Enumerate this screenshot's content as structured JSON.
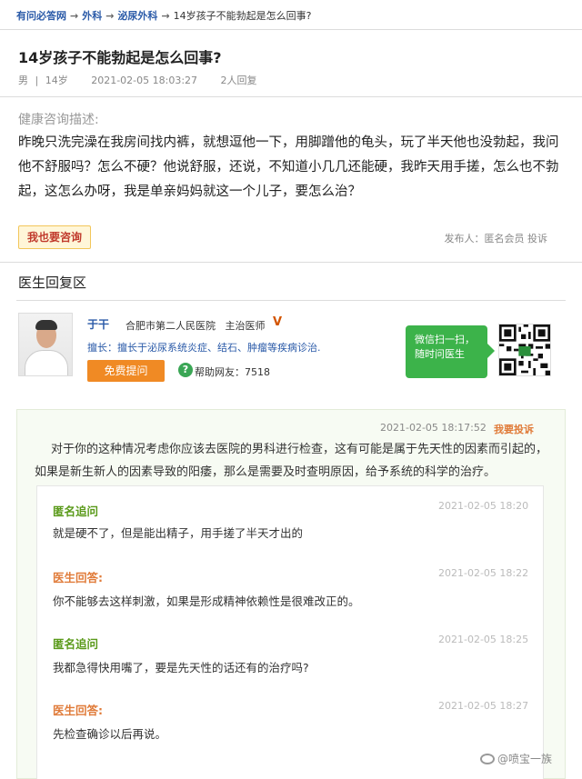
{
  "breadcrumb": {
    "items": [
      "有问必答网",
      "外科",
      "泌尿外科"
    ],
    "current": "14岁孩子不能勃起是怎么回事?",
    "separator": "→"
  },
  "question": {
    "title": "14岁孩子不能勃起是怎么回事?",
    "gender": "男",
    "divider": "|",
    "age": "14岁",
    "datetime": "2021-02-05 18:03:27",
    "reply_count": "2人回复",
    "desc_label": "健康咨询描述:",
    "description": "昨晚只洗完澡在我房间找内裤，就想逗他一下，用脚蹭他的龟头，玩了半天他也没勃起，我问他不舒服吗？怎么不硬？他说舒服，还说，不知道小几几还能硬，我昨天用手搓，怎么也不勃起，这怎么办呀，我是单亲妈妈就这一个儿子，要怎么治？",
    "ask_button": "我也要咨询",
    "publisher": "发布人：匿名会员  投诉"
  },
  "reply_section": {
    "title": "医生回复区",
    "doctor": {
      "name": "于干",
      "hospital": "合肥市第二人民医院",
      "position": "主治医师",
      "v_badge": "V",
      "specialty": "擅长：擅长于泌尿系统炎症、结石、肿瘤等疾病诊治.",
      "free_button": "免费提问",
      "help_icon": "?",
      "helped": "帮助网友：7518"
    },
    "wechat": {
      "line1": "微信扫一扫，",
      "line2": "随时问医生"
    }
  },
  "reply": {
    "time": "2021-02-05 18:17:52",
    "complain": "我要投诉",
    "text": "对于你的这种情况考虑你应该去医院的男科进行检查，这有可能是属于先天性的因素而引起的，如果是新生新人的因素导致的阳痿，那么是需要及时查明原因，给予系统的科学的治疗。",
    "thread": [
      {
        "type": "q",
        "label": "匿名追问",
        "time": "2021-02-05 18:20",
        "text": "就是硬不了，但是能出精子，用手搓了半天才出的"
      },
      {
        "type": "a",
        "label": "医生回答:",
        "time": "2021-02-05 18:22",
        "text": "你不能够去这样刺激，如果是形成精神依赖性是很难改正的。"
      },
      {
        "type": "q",
        "label": "匿名追问",
        "time": "2021-02-05 18:25",
        "text": "我都急得快用嘴了，要是先天性的话还有的治疗吗?"
      },
      {
        "type": "a",
        "label": "医生回答:",
        "time": "2021-02-05 18:27",
        "text": "先检查确诊以后再说。"
      }
    ]
  },
  "watermark": "@喷宝一族",
  "colors": {
    "link": "#2a5aa8",
    "accent": "#e07b39",
    "green": "#3cb34a"
  }
}
